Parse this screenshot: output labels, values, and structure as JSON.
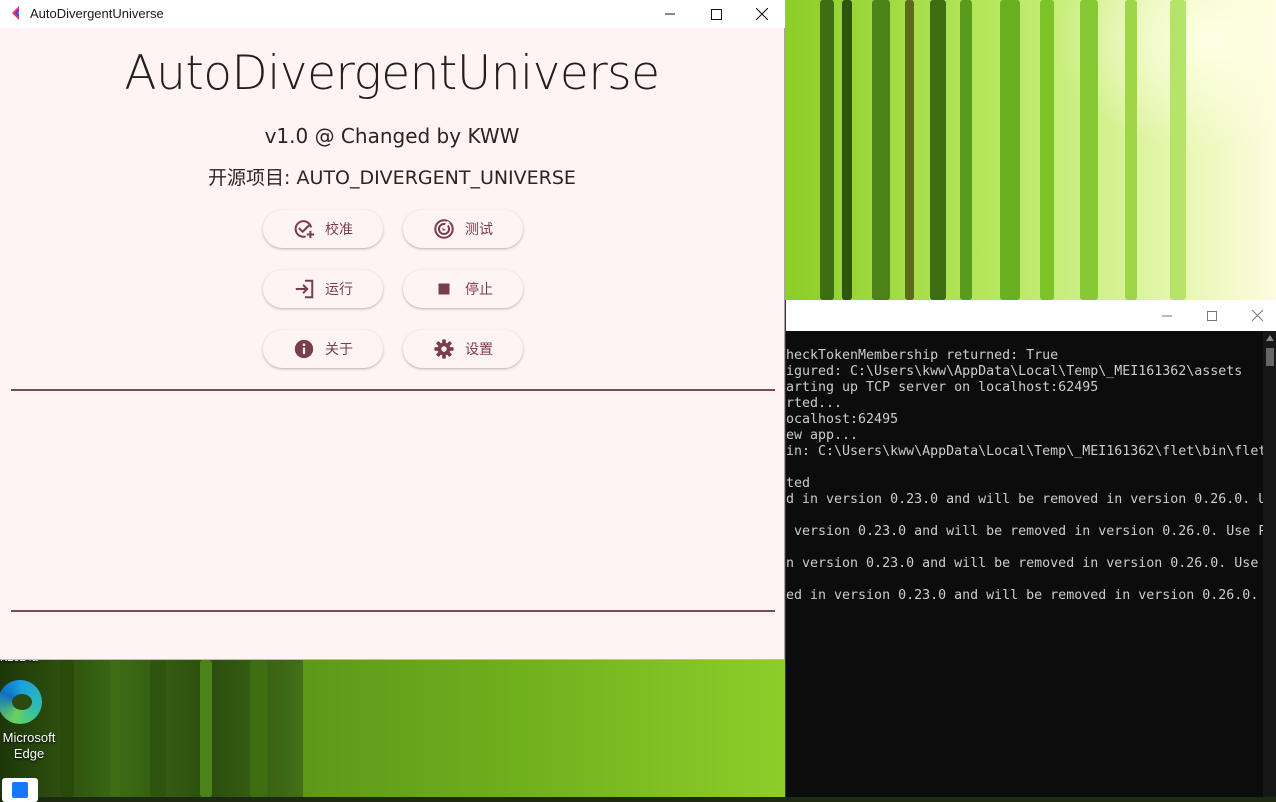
{
  "app": {
    "window_title": "AutoDivergentUniverse",
    "headline": "AutoDivergentUniverse",
    "version_line": "v1.0 @ Changed by KWW",
    "project_line": "开源项目: AUTO_DIVERGENT_UNIVERSE",
    "buttons": {
      "calibrate": "校准",
      "test": "测试",
      "run": "运行",
      "stop": "停止",
      "about": "关于",
      "settings": "设置"
    },
    "accent_color": "#7a3e48",
    "background_color": "#fff4f4"
  },
  "desktop": {
    "icons": [
      {
        "label": "Microsoft Edge",
        "icon": "edge-icon"
      }
    ],
    "partial_label": "K2024a"
  },
  "console": {
    "lines": [
      "heckTokenMembership returned: True",
      "igured: C:\\Users\\kww\\AppData\\Local\\Temp\\_MEI161362\\assets",
      "arting up TCP server on localhost:62495",
      "rted...",
      "ocalhost:62495",
      "ew app...",
      "in: C:\\Users\\kww\\AppData\\Local\\Temp\\_MEI161362\\flet\\bin\\flet",
      "",
      "ted",
      "d in version 0.23.0 and will be removed in version 0.26.0. U",
      "",
      " version 0.23.0 and will be removed in version 0.26.0. Use P",
      "",
      "n version 0.23.0 and will be removed in version 0.26.0. Use",
      "",
      "ed in version 0.23.0 and will be removed in version 0.26.0."
    ]
  }
}
